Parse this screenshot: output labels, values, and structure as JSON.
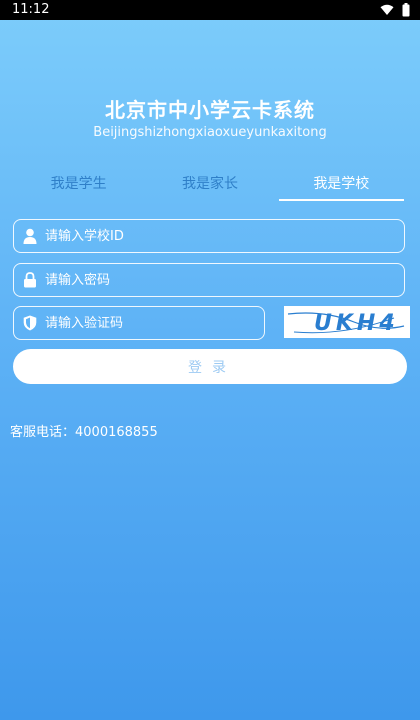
{
  "status_bar": {
    "time": "11:12"
  },
  "app": {
    "title": "北京市中小学云卡系统",
    "subtitle": "Beijingshizhongxiaoxueyunkaxitong"
  },
  "tabs": [
    {
      "label": "我是学生",
      "active": false
    },
    {
      "label": "我是家长",
      "active": false
    },
    {
      "label": "我是学校",
      "active": true
    }
  ],
  "form": {
    "school_id": {
      "placeholder": "请输入学校ID",
      "value": "",
      "icon": "user-icon"
    },
    "password": {
      "placeholder": "请输入密码",
      "value": "",
      "icon": "lock-icon"
    },
    "captcha": {
      "placeholder": "请输入验证码",
      "value": "",
      "icon": "shield-icon",
      "image_text": "UKH4"
    },
    "login_label": "登录"
  },
  "footer": {
    "hotline_label": "客服电话：",
    "hotline_number": "4000168855"
  },
  "colors": {
    "bg_top": "#7dcdfb",
    "bg_bottom": "#3e98ec",
    "inactive_tab": "#2f7fc8",
    "login_text": "#9ecbf3",
    "captcha_text": "#2a7ed0"
  }
}
